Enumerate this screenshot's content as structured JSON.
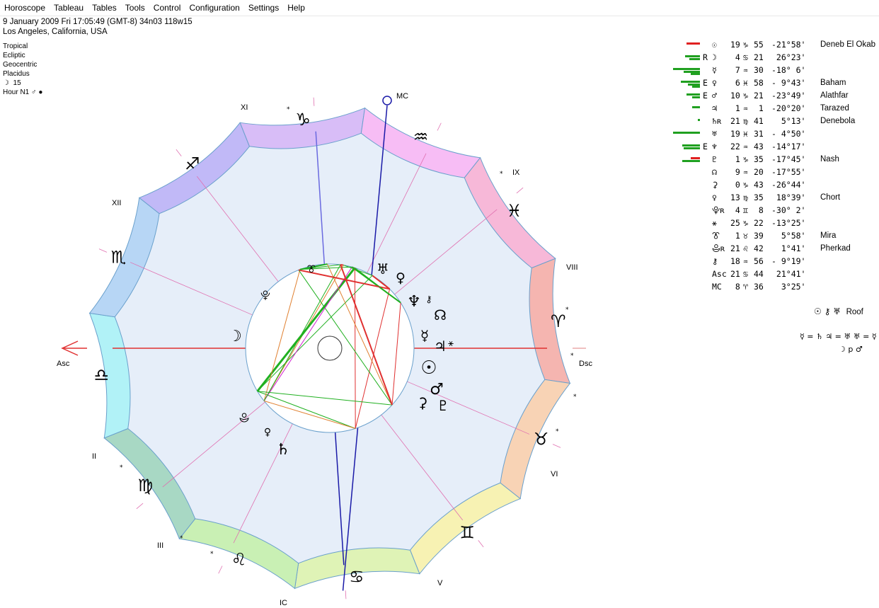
{
  "menu": [
    "Horoscope",
    "Tableau",
    "Tables",
    "Tools",
    "Control",
    "Configuration",
    "Settings",
    "Help"
  ],
  "header": {
    "date_line": "9 January 2009  Fri  17:05:49 (GMT-8) 34n03  118w15",
    "place": "Los Angeles, California, USA",
    "zodiac": "Tropical",
    "plane": "Ecliptic",
    "center": "Geocentric",
    "house_system": "Placidus",
    "moon_day_symbol": "☽",
    "moon_day": "15",
    "hour_label": "Hour N1",
    "hour_ruler": "♂",
    "hour_dot": "●"
  },
  "houses": {
    "angles": {
      "asc": "Asc",
      "dsc": "Dsc",
      "mc": "MC",
      "ic": "IC"
    },
    "numerals": [
      "II",
      "III",
      "V",
      "VI",
      "VIII",
      "IX",
      "XI",
      "XII"
    ]
  },
  "zodiac_signs": [
    "♈",
    "♉",
    "♊",
    "♋",
    "♌",
    "♍",
    "♎",
    "♏",
    "♐",
    "♑",
    "♒",
    "♓"
  ],
  "zodiac_colors": [
    "#f5b5b0",
    "#f8d3b5",
    "#f7f2b3",
    "#dff3b6",
    "#c9f0b4",
    "#a8d8c4",
    "#b1f2f7",
    "#b7d6f5",
    "#c1b9f7",
    "#d8bdf7",
    "#f7bdf5",
    "#f7b8d8"
  ],
  "chart_glyphs": [
    {
      "symbol": "♅",
      "name": "uranus"
    },
    {
      "symbol": "♀",
      "name": "venus"
    },
    {
      "symbol": "♆",
      "name": "neptune"
    },
    {
      "symbol": "⚷",
      "name": "chiron"
    },
    {
      "symbol": "☊",
      "name": "node"
    },
    {
      "symbol": "☿",
      "name": "mercury"
    },
    {
      "symbol": "♃",
      "name": "jupiter"
    },
    {
      "symbol": "⚹",
      "name": "sextile-point"
    },
    {
      "symbol": "☉",
      "name": "sun"
    },
    {
      "symbol": "♂",
      "name": "mars"
    },
    {
      "symbol": "⚳",
      "name": "ceres"
    },
    {
      "symbol": "♇",
      "name": "pluto"
    },
    {
      "symbol": "♄",
      "name": "saturn"
    },
    {
      "symbol": "♀",
      "name": "lilith-point"
    },
    {
      "symbol": "⯓",
      "name": "proserpina"
    },
    {
      "symbol": "☽",
      "name": "moon"
    },
    {
      "symbol": "⯕",
      "name": "vesta"
    },
    {
      "symbol": "⯔",
      "name": "transpluto"
    }
  ],
  "planets": [
    {
      "glyph": "☉",
      "flag": "",
      "pos": "19",
      "sign": "♑",
      "min": "55",
      "lat": "-21°58'",
      "star": "Deneb El Okab"
    },
    {
      "glyph": "☽",
      "flag": "R",
      "pos": " 4",
      "sign": "♋",
      "min": "21",
      "lat": " 26°23'",
      "star": ""
    },
    {
      "glyph": "☿",
      "flag": "",
      "pos": " 7",
      "sign": "♒",
      "min": "30",
      "lat": "-18° 6'",
      "star": ""
    },
    {
      "glyph": "♀",
      "flag": "E",
      "pos": " 6",
      "sign": "♓",
      "min": "58",
      "lat": "- 9°43'",
      "star": "Baham"
    },
    {
      "glyph": "♂",
      "flag": "E",
      "pos": "10",
      "sign": "♑",
      "min": "21",
      "lat": "-23°49'",
      "star": "Alathfar"
    },
    {
      "glyph": "♃",
      "flag": "",
      "pos": " 1",
      "sign": "♒",
      "min": " 1",
      "lat": "-20°20'",
      "star": "Tarazed"
    },
    {
      "glyph": "♄ʀ",
      "flag": "",
      "pos": "21",
      "sign": "♍",
      "min": "41",
      "lat": "  5°13'",
      "star": "Denebola"
    },
    {
      "glyph": "♅",
      "flag": "",
      "pos": "19",
      "sign": "♓",
      "min": "31",
      "lat": "- 4°50'",
      "star": ""
    },
    {
      "glyph": "♆",
      "flag": "E",
      "pos": "22",
      "sign": "♒",
      "min": "43",
      "lat": "-14°17'",
      "star": ""
    },
    {
      "glyph": "♇",
      "flag": "",
      "pos": " 1",
      "sign": "♑",
      "min": "35",
      "lat": "-17°45'",
      "star": "Nash"
    },
    {
      "glyph": "☊",
      "flag": "",
      "pos": " 9",
      "sign": "♒",
      "min": "20",
      "lat": "-17°55'",
      "star": ""
    },
    {
      "glyph": "⚳",
      "flag": "",
      "pos": " 0",
      "sign": "♑",
      "min": "43",
      "lat": "-26°44'",
      "star": ""
    },
    {
      "glyph": "♀",
      "flag": "",
      "pos": "13",
      "sign": "♍",
      "min": "35",
      "lat": " 18°39'",
      "star": "Chort"
    },
    {
      "glyph": "⯓ʀ",
      "flag": "",
      "pos": " 4",
      "sign": "♊",
      "min": " 8",
      "lat": "-30° 2'",
      "star": ""
    },
    {
      "glyph": "⚹",
      "flag": "",
      "pos": "25",
      "sign": "♑",
      "min": "22",
      "lat": "-13°25'",
      "star": ""
    },
    {
      "glyph": "⯔",
      "flag": "",
      "pos": " 1",
      "sign": "♉",
      "min": "39",
      "lat": "  5°58'",
      "star": "Mira"
    },
    {
      "glyph": "⯕ʀ",
      "flag": "",
      "pos": "21",
      "sign": "♌",
      "min": "42",
      "lat": "  1°41'",
      "star": "Pherkad"
    },
    {
      "glyph": "⚷",
      "flag": "",
      "pos": "18",
      "sign": "♒",
      "min": "56",
      "lat": "- 9°19'",
      "star": ""
    },
    {
      "glyph": "Asc",
      "flag": "",
      "pos": "21",
      "sign": "♋",
      "min": "44",
      "lat": " 21°41'",
      "star": ""
    },
    {
      "glyph": "MC",
      "flag": "",
      "pos": " 8",
      "sign": "♈",
      "min": "36",
      "lat": "  3°25'",
      "star": ""
    }
  ],
  "strength_bars": [
    [
      {
        "c": "#e02020",
        "v": 0.5
      }
    ],
    [
      {
        "c": "#20a020",
        "v": 0.55
      },
      {
        "c": "#20a020",
        "v": 0.4
      }
    ],
    [
      {
        "c": "#20a020",
        "v": 1.0
      },
      {
        "c": "#20a020",
        "v": 0.6
      },
      {
        "c": "#20a020",
        "v": 0.35
      }
    ],
    [
      {
        "c": "#20a020",
        "v": 0.7
      },
      {
        "c": "#20a020",
        "v": 0.45
      },
      {
        "c": "#20a020",
        "v": 0.3
      }
    ],
    [
      {
        "c": "#20a020",
        "v": 0.5
      },
      {
        "c": "#20a020",
        "v": 0.3
      }
    ],
    [
      {
        "c": "#20a020",
        "v": 0.3
      }
    ],
    [
      {
        "c": "#20a020",
        "v": 0.08
      }
    ],
    [
      {
        "c": "#20a020",
        "v": 1.0
      }
    ],
    [
      {
        "c": "#20a020",
        "v": 0.65
      },
      {
        "c": "#20a020",
        "v": 0.6
      }
    ],
    [
      {
        "c": "#e02020",
        "v": 0.35
      },
      {
        "c": "#20a020",
        "v": 0.65
      }
    ]
  ],
  "roof": {
    "glyphs": "☉ ⚷ ♅",
    "label": "Roof"
  },
  "aspect_line1": "☿ = ♄  ♃ = ♅  ♅ = ☿",
  "aspect_line2": "☽ p ♂"
}
